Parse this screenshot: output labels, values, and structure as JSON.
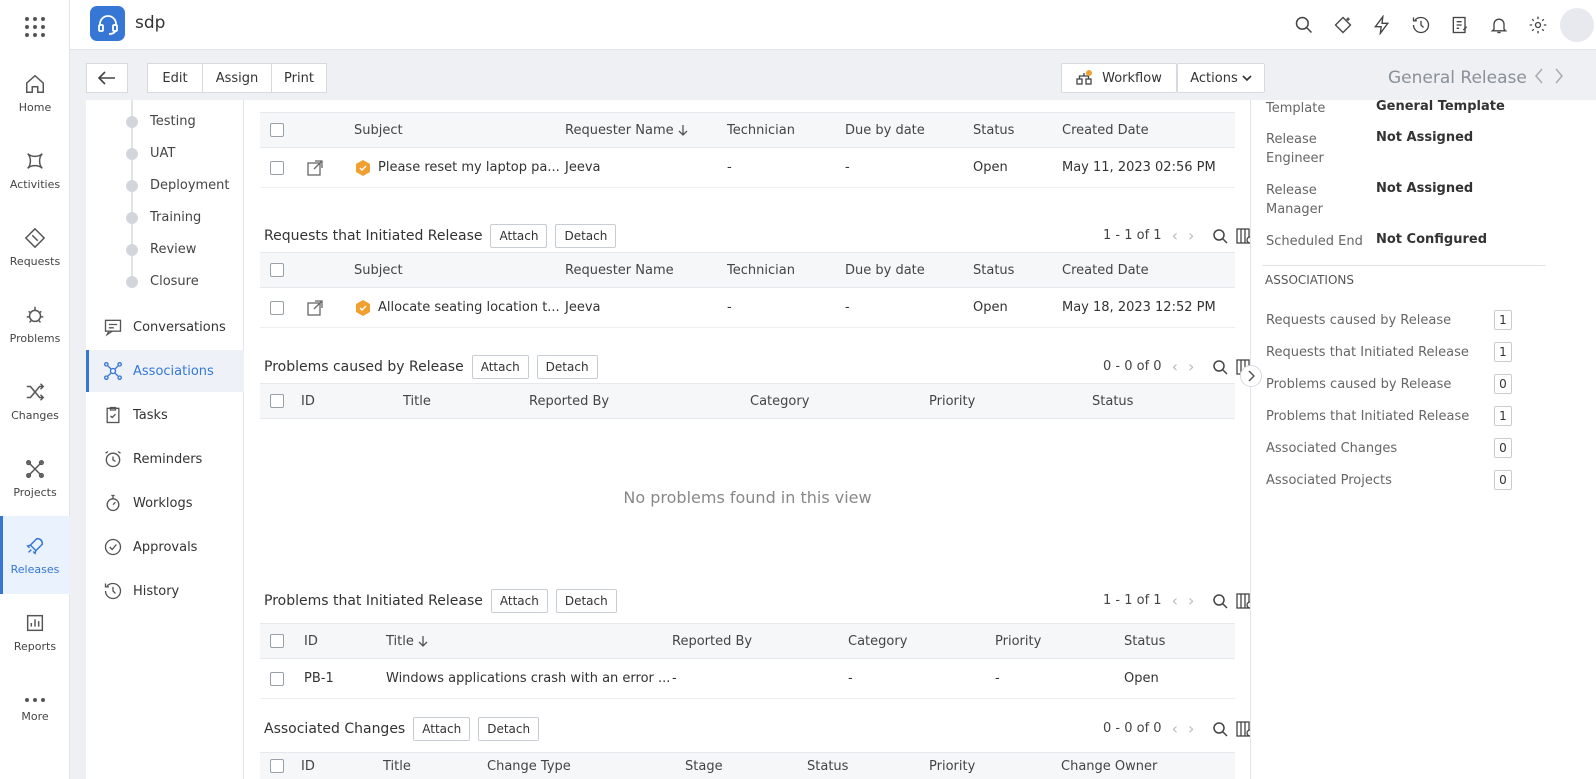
{
  "app": {
    "name": "sdp"
  },
  "rail": {
    "items": [
      {
        "label": "Home"
      },
      {
        "label": "Activities"
      },
      {
        "label": "Requests"
      },
      {
        "label": "Problems"
      },
      {
        "label": "Changes"
      },
      {
        "label": "Projects"
      },
      {
        "label": "Releases"
      },
      {
        "label": "Reports"
      },
      {
        "label": "More"
      }
    ]
  },
  "toolbar": {
    "edit": "Edit",
    "assign": "Assign",
    "print": "Print",
    "workflow": "Workflow",
    "actions": "Actions",
    "title": "General Release"
  },
  "stages": [
    "Testing",
    "UAT",
    "Deployment",
    "Training",
    "Review",
    "Closure"
  ],
  "subnav": [
    "Conversations",
    "Associations",
    "Tasks",
    "Reminders",
    "Worklogs",
    "Approvals",
    "History"
  ],
  "buttons": {
    "attach": "Attach",
    "detach": "Detach"
  },
  "sections": {
    "requests_caused": {
      "headers": [
        "Subject",
        "Requester Name",
        "Technician",
        "Due by date",
        "Status",
        "Created Date"
      ],
      "rows": [
        {
          "subject": "Please reset my laptop pa...",
          "requester": "Jeeva",
          "technician": "-",
          "due": "-",
          "status": "Open",
          "created": "May 11, 2023 02:56 PM"
        }
      ]
    },
    "requests_initiated": {
      "title": "Requests that Initiated Release",
      "pager": "1 - 1 of 1",
      "headers": [
        "Subject",
        "Requester Name",
        "Technician",
        "Due by date",
        "Status",
        "Created Date"
      ],
      "rows": [
        {
          "subject": "Allocate seating location t...",
          "requester": "Jeeva",
          "technician": "-",
          "due": "-",
          "status": "Open",
          "created": "May 18, 2023 12:52 PM"
        }
      ]
    },
    "problems_caused": {
      "title": "Problems caused by Release",
      "pager": "0 - 0 of 0",
      "headers": [
        "ID",
        "Title",
        "Reported By",
        "Category",
        "Priority",
        "Status"
      ],
      "empty": "No problems found in this view"
    },
    "problems_initiated": {
      "title": "Problems that Initiated Release",
      "pager": "1 - 1 of 1",
      "headers": [
        "ID",
        "Title",
        "Reported By",
        "Category",
        "Priority",
        "Status"
      ],
      "rows": [
        {
          "id": "PB-1",
          "title": "Windows applications crash with an error ...",
          "reported_by": "-",
          "category": "-",
          "priority": "-",
          "status": "Open"
        }
      ]
    },
    "associated_changes": {
      "title": "Associated Changes",
      "pager": "0 - 0 of 0",
      "headers": [
        "ID",
        "Title",
        "Change Type",
        "Stage",
        "Status",
        "Priority",
        "Change Owner"
      ]
    }
  },
  "details": {
    "fields": [
      {
        "label": "Template",
        "value": "General Template"
      },
      {
        "label": "Release Engineer",
        "value": "Not Assigned"
      },
      {
        "label": "Release Manager",
        "value": "Not Assigned"
      },
      {
        "label": "Scheduled End",
        "value": "Not Configured"
      }
    ],
    "associations_heading": "ASSOCIATIONS",
    "associations": [
      {
        "label": "Requests caused by Release",
        "count": "1"
      },
      {
        "label": "Requests that Initiated Release",
        "count": "1"
      },
      {
        "label": "Problems caused by Release",
        "count": "0"
      },
      {
        "label": "Problems that Initiated Release",
        "count": "1"
      },
      {
        "label": "Associated Changes",
        "count": "0"
      },
      {
        "label": "Associated Projects",
        "count": "0"
      }
    ]
  }
}
